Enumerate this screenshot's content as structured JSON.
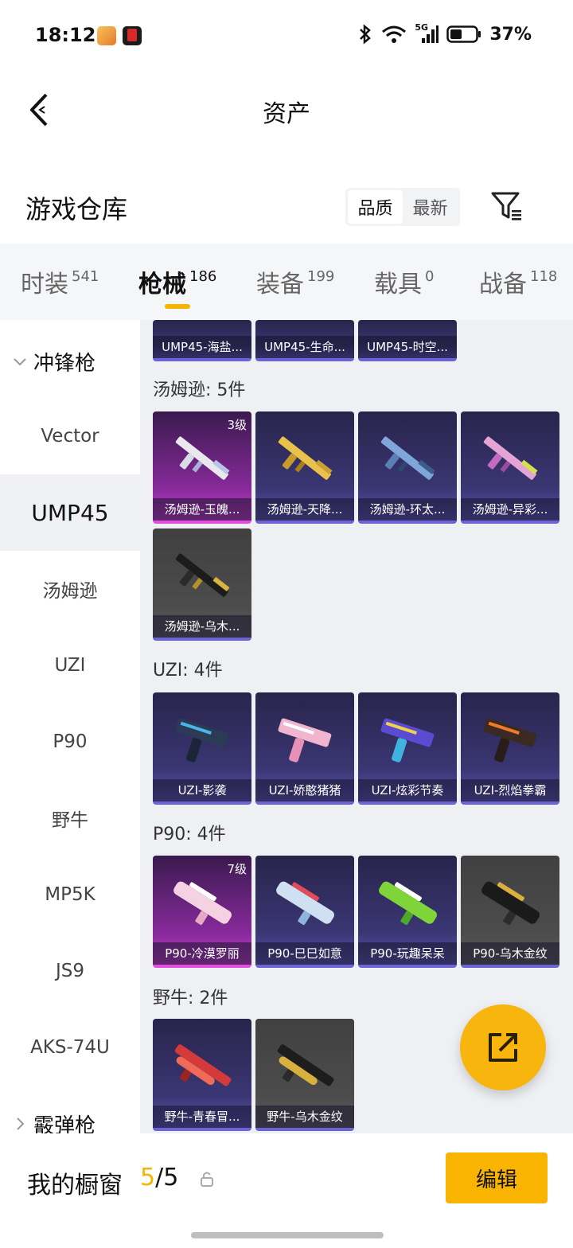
{
  "status_bar": {
    "time": "18:12",
    "network": "5G",
    "battery": "37%"
  },
  "nav": {
    "title": "资产"
  },
  "warehouse": {
    "title": "游戏仓库",
    "sort_options": [
      "品质",
      "最新"
    ],
    "active_sort": "品质"
  },
  "tabs": [
    {
      "label": "时装",
      "count": "541"
    },
    {
      "label": "枪械",
      "count": "186"
    },
    {
      "label": "装备",
      "count": "199"
    },
    {
      "label": "载具",
      "count": "0"
    },
    {
      "label": "战备",
      "count": "118"
    }
  ],
  "sidebar": {
    "group_open": "冲锋枪",
    "items": [
      "Vector",
      "UMP45",
      "汤姆逊",
      "UZI",
      "P90",
      "野牛",
      "MP5K",
      "JS9",
      "AKS-74U"
    ],
    "active_item": "UMP45",
    "group_closed": "霰弹枪"
  },
  "content": {
    "top_row": [
      "UMP45-海盐...",
      "UMP45-生命...",
      "UMP45-时空..."
    ],
    "groups": [
      {
        "title": "汤姆逊: 5件",
        "items": [
          {
            "name": "汤姆逊-玉魄...",
            "level": "3级",
            "tone": "pink"
          },
          {
            "name": "汤姆逊-天降...",
            "level": "",
            "tone": "purple"
          },
          {
            "name": "汤姆逊-环太...",
            "level": "",
            "tone": "purple"
          },
          {
            "name": "汤姆逊-异彩...",
            "level": "",
            "tone": "purple"
          },
          {
            "name": "汤姆逊-乌木...",
            "level": "",
            "tone": "gray"
          }
        ]
      },
      {
        "title": "UZI: 4件",
        "items": [
          {
            "name": "UZI-影袭",
            "level": "",
            "tone": "purple"
          },
          {
            "name": "UZI-娇憨猪猪",
            "level": "",
            "tone": "purple"
          },
          {
            "name": "UZI-炫彩节奏",
            "level": "",
            "tone": "purple"
          },
          {
            "name": "UZI-烈焰拳霸",
            "level": "",
            "tone": "purple"
          }
        ]
      },
      {
        "title": "P90: 4件",
        "items": [
          {
            "name": "P90-冷漠罗丽",
            "level": "7级",
            "tone": "pink"
          },
          {
            "name": "P90-巳巳如意",
            "level": "",
            "tone": "purple"
          },
          {
            "name": "P90-玩趣呆呆",
            "level": "",
            "tone": "purple"
          },
          {
            "name": "P90-乌木金纹",
            "level": "",
            "tone": "gray"
          }
        ]
      },
      {
        "title": "野牛: 2件",
        "items": [
          {
            "name": "野牛-青春冒...",
            "level": "",
            "tone": "purple"
          },
          {
            "name": "野牛-乌木金纹",
            "level": "",
            "tone": "gray"
          }
        ]
      }
    ]
  },
  "bottom": {
    "showcase_label": "我的橱窗",
    "current": "5",
    "total": "/5",
    "edit_label": "编辑"
  },
  "colors": {
    "accent": "#f5b400",
    "rare_purple": "#6b63d6",
    "rare_pink": "#e24fe0"
  },
  "icons": [
    "back-icon",
    "bluetooth-icon",
    "wifi-icon",
    "signal-icon",
    "battery-icon",
    "filter-icon",
    "chevron-down-icon",
    "chevron-right-icon",
    "lock-icon",
    "share-icon"
  ]
}
